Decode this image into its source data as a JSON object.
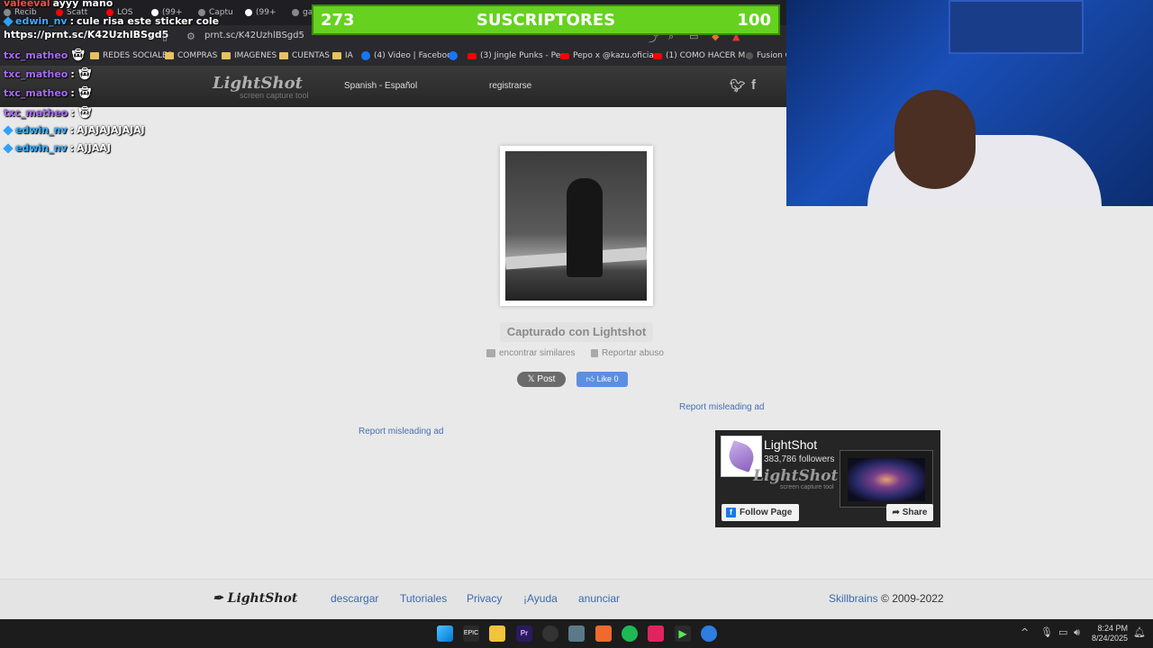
{
  "browser": {
    "tabs": [
      {
        "label": "Recib",
        "icon": "gmail-icon"
      },
      {
        "label": "Scatt",
        "icon": "youtube-icon"
      },
      {
        "label": "LOS",
        "icon": "youtube-icon"
      },
      {
        "label": "(99+",
        "icon": "tiktok-icon"
      },
      {
        "label": "Captu",
        "icon": "tiktok-icon"
      },
      {
        "label": "(99+",
        "icon": "tiktok-icon"
      },
      {
        "label": "ga",
        "icon": "globe-icon"
      }
    ],
    "tooltip_url": "https://prnt.sc/K42UzhlBSgd5",
    "url": "prnt.sc/K42UzhlBSgd5",
    "bookmarks": [
      {
        "label": "REDES SOCIALES",
        "type": "folder"
      },
      {
        "label": "COMPRAS",
        "type": "folder"
      },
      {
        "label": "IMAGENES",
        "type": "folder"
      },
      {
        "label": "CUENTAS",
        "type": "folder"
      },
      {
        "label": "IA",
        "type": "folder"
      },
      {
        "label": "(4) Video | Facebook",
        "type": "facebook"
      },
      {
        "label": "",
        "type": "facebook"
      },
      {
        "label": "(3) Jingle Punks - Pe...",
        "type": "youtube"
      },
      {
        "label": "Pepo x @kazu.oficia...",
        "type": "youtube"
      },
      {
        "label": "(1) COMO HACER M...",
        "type": "youtube"
      },
      {
        "label": "Fusion Cl",
        "type": "other"
      }
    ]
  },
  "overlay": {
    "subscribers": {
      "left": "273",
      "label": "SUSCRIPTORES",
      "right": "100"
    },
    "chat": [
      {
        "user": "valeeval",
        "msg": "ayyy mano",
        "style": "user"
      },
      {
        "user": "edwin_nv",
        "msg": "cule risa este sticker cole",
        "style": "user2"
      },
      {
        "user": "txc_matheo",
        "msg": "",
        "style": "user"
      },
      {
        "user": "txc_matheo",
        "msg": "",
        "style": "user"
      },
      {
        "user": "txc_matheo",
        "msg": "",
        "style": "user"
      },
      {
        "user": "txc_matheo",
        "msg": "",
        "style": "user"
      },
      {
        "user": "edwin_nv",
        "msg": "AJAJAJAJAJAJ",
        "style": "user2"
      },
      {
        "user": "edwin_nv",
        "msg": "AJJAAJ",
        "style": "user2"
      }
    ]
  },
  "lightshot": {
    "logo": "LightShot",
    "logo_sub": "screen capture tool",
    "language": "Spanish - Español",
    "register": "registrarse",
    "caption": "Capturado con Lightshot",
    "find_similar": "encontrar similares",
    "report_abuse": "Reportar abuso",
    "post": "𝕏 Post",
    "like": "Like 0",
    "report_ad": "Report misleading ad"
  },
  "fb_widget": {
    "name": "LightShot",
    "followers": "383,786 followers",
    "logo": "LightShot",
    "logo_sub": "screen capture tool",
    "follow": "Follow Page",
    "share": "Share"
  },
  "footer": {
    "logo": "LightShot",
    "links": [
      "descargar",
      "Tutoriales",
      "Privacy",
      "¡Ayuda",
      "anunciar"
    ],
    "company": "Skillbrains",
    "copyright": "© 2009-2022"
  },
  "taskbar": {
    "time": "8:24 PM",
    "date": "8/24/2025"
  }
}
